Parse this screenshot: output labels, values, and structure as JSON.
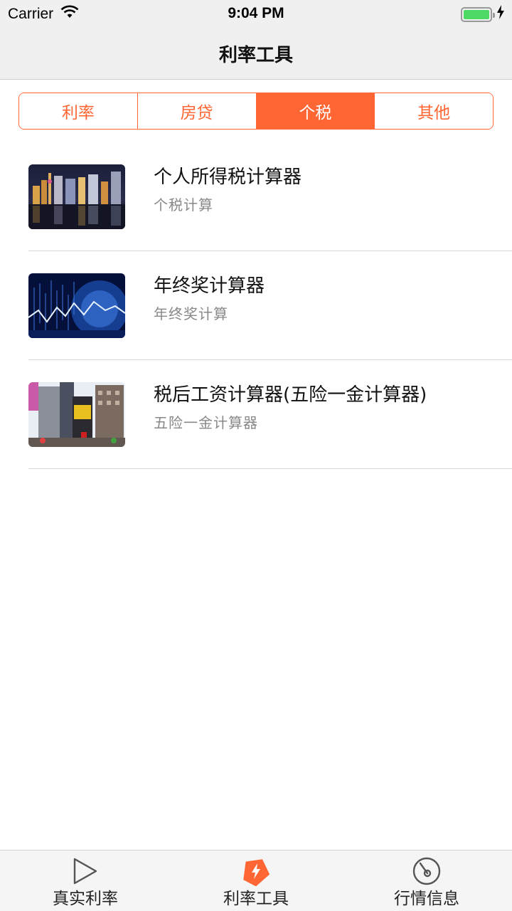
{
  "status_bar": {
    "carrier": "Carrier",
    "time": "9:04 PM",
    "battery_percent": 100
  },
  "nav": {
    "title": "利率工具"
  },
  "segments": [
    {
      "label": "利率",
      "active": false
    },
    {
      "label": "房贷",
      "active": false
    },
    {
      "label": "个税",
      "active": true
    },
    {
      "label": "其他",
      "active": false
    }
  ],
  "items": [
    {
      "title": "个人所得税计算器",
      "subtitle": "个税计算",
      "thumb": "city-night-photo"
    },
    {
      "title": "年终奖计算器",
      "subtitle": "年终奖计算",
      "thumb": "stock-chart-photo"
    },
    {
      "title": "税后工资计算器(五险一金计算器)",
      "subtitle": "五险一金计算器",
      "thumb": "city-street-photo"
    }
  ],
  "tabs": [
    {
      "label": "真实利率",
      "icon": "play-icon",
      "active": false
    },
    {
      "label": "利率工具",
      "icon": "lightning-tag-icon",
      "active": true
    },
    {
      "label": "行情信息",
      "icon": "gauge-icon",
      "active": false
    }
  ],
  "colors": {
    "accent": "#ff6633",
    "battery": "#4cd964"
  }
}
